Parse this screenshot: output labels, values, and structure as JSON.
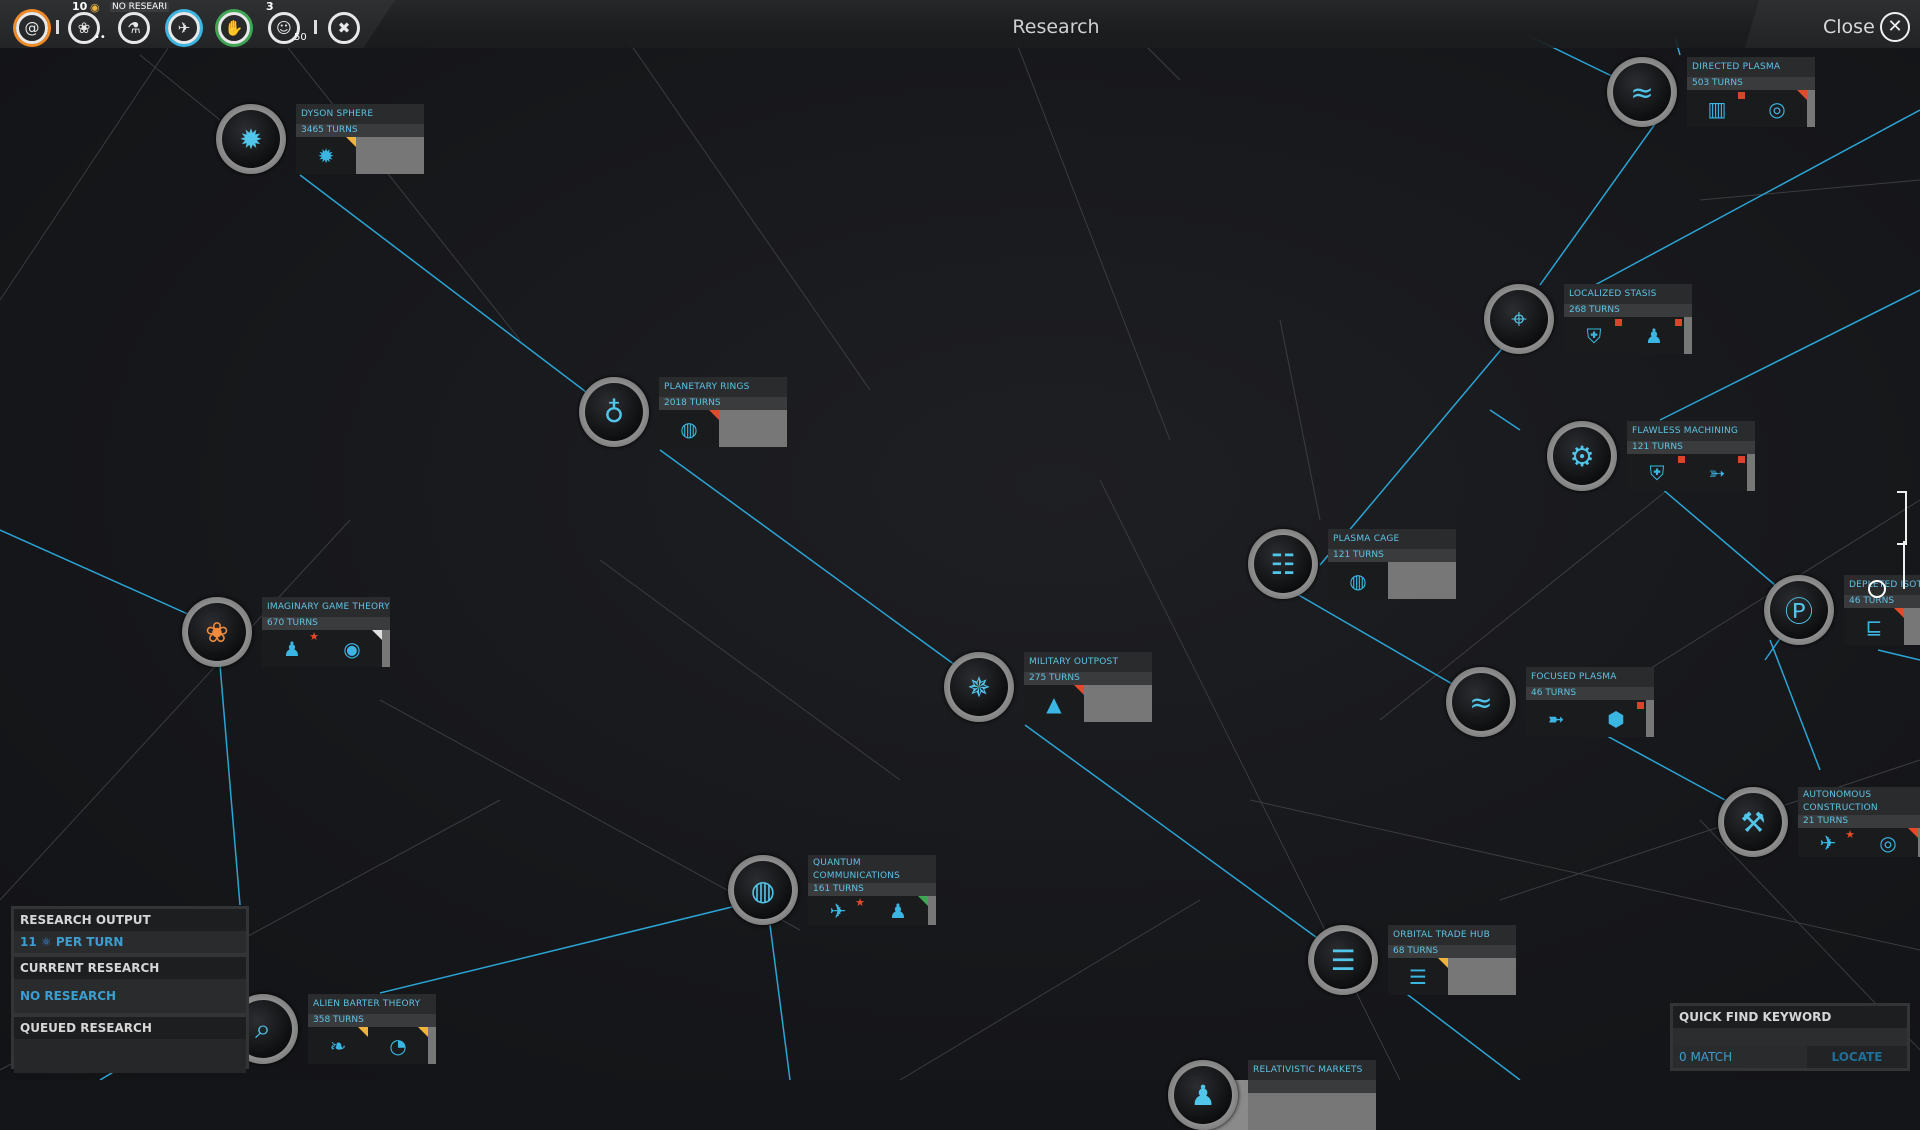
{
  "window": {
    "title": "Research",
    "close_label": "Close",
    "close_icon": "close-circle-icon"
  },
  "toolbar": {
    "items": [
      {
        "name": "galaxy",
        "icon": "spiral-galaxy-icon",
        "glyph": "@",
        "ring": "#f08a24"
      },
      {
        "name": "empire",
        "icon": "laurel-wreath-icon",
        "glyph": "❀",
        "badge_top": "10",
        "badge_icon": "gold-coin-icon",
        "sub_badge": "••"
      },
      {
        "name": "research",
        "icon": "microscope-icon",
        "glyph": "⚗",
        "label": "NO RESEARI",
        "sub_badge": "-"
      },
      {
        "name": "military",
        "icon": "eagle-icon",
        "glyph": "✈",
        "ring": "#3bb6e3"
      },
      {
        "name": "diplomacy",
        "icon": "handshake-icon",
        "glyph": "✋",
        "ring": "#3fa654"
      },
      {
        "name": "population",
        "icon": "people-icon",
        "glyph": "☺",
        "badge_top": "3",
        "sub_badge": "50"
      },
      {
        "name": "settings",
        "icon": "wrench-screwdriver-icon",
        "glyph": "✖"
      }
    ]
  },
  "colors": {
    "accent": "#5ec3e6",
    "line": "#2aa5d6",
    "faint_line": "#3a3c40",
    "warning": "#e24b2a",
    "bonus": "#f0b43c",
    "good": "#3fa654"
  },
  "techs": [
    {
      "id": "dyson-sphere",
      "name": "DYSON SPHERE",
      "turns": "3465 TURNS",
      "icon": "sun-ring-icon",
      "glyph": "✹",
      "unlocks": [
        {
          "icon": "sun-ring-icon",
          "glyph": "✹",
          "flag": "rainbow"
        }
      ]
    },
    {
      "id": "directed-plasma",
      "name": "DIRECTED PLASMA",
      "turns": "503 TURNS",
      "icon": "plasma-beam-icon",
      "glyph": "≈",
      "unlocks": [
        {
          "icon": "battery-cells-icon",
          "glyph": "▥",
          "flag": "square"
        },
        {
          "icon": "laurel-target-icon",
          "glyph": "◎",
          "flag": "corner"
        }
      ]
    },
    {
      "id": "localized-stasis",
      "name": "LOCALIZED STASIS",
      "turns": "268 TURNS",
      "icon": "location-pin-icon",
      "glyph": "⌖",
      "unlocks": [
        {
          "icon": "shield-icon",
          "glyph": "⛨",
          "flag": "square"
        },
        {
          "icon": "engineer-icon",
          "glyph": "♟",
          "flag": "square"
        }
      ]
    },
    {
      "id": "flawless-machining",
      "name": "FLAWLESS MACHINING",
      "turns": "121 TURNS",
      "icon": "gears-icon",
      "glyph": "⚙",
      "unlocks": [
        {
          "icon": "shield-icon",
          "glyph": "⛨",
          "flag": "square"
        },
        {
          "icon": "projectile-crew-icon",
          "glyph": "➳",
          "flag": "square"
        }
      ]
    },
    {
      "id": "planetary-rings",
      "name": "PLANETARY RINGS",
      "turns": "2018 TURNS",
      "icon": "ringed-planet-icon",
      "glyph": "♁",
      "unlocks": [
        {
          "icon": "globe-ring-icon",
          "glyph": "◍",
          "flag": "corner"
        }
      ]
    },
    {
      "id": "plasma-cage",
      "name": "PLASMA CAGE",
      "turns": "121 TURNS",
      "icon": "cage-lightning-icon",
      "glyph": "☷",
      "unlocks": [
        {
          "icon": "globe-lightning-icon",
          "glyph": "◍",
          "flag": ""
        }
      ]
    },
    {
      "id": "depleted-isotopes",
      "name": "DEPLETED ISOTOPES",
      "turns": "46 TURNS",
      "icon": "neutron-proton-icon",
      "glyph": "Ⓟ",
      "unlocks": [
        {
          "icon": "clamp-icon",
          "glyph": "⊑",
          "flag": "corner"
        }
      ]
    },
    {
      "id": "imaginary-game-theory",
      "name": "IMAGINARY GAME THEORY",
      "turns": "670 TURNS",
      "icon": "butterfly-icon",
      "glyph": "❀",
      "unlocks": [
        {
          "icon": "alien-crowd-icon",
          "glyph": "♟",
          "flag": "star"
        },
        {
          "icon": "broadcast-icon",
          "glyph": "◉",
          "flag": "corner-white"
        }
      ]
    },
    {
      "id": "military-outpost",
      "name": "MILITARY OUTPOST",
      "turns": "275 TURNS",
      "icon": "eagle-globe-icon",
      "glyph": "✵",
      "unlocks": [
        {
          "icon": "starfleet-icon",
          "glyph": "▲",
          "flag": "corner"
        }
      ]
    },
    {
      "id": "focused-plasma",
      "name": "FOCUSED PLASMA",
      "turns": "46 TURNS",
      "icon": "plasma-beam-icon",
      "glyph": "≈",
      "unlocks": [
        {
          "icon": "plasma-bolt-icon",
          "glyph": "➼",
          "flag": ""
        },
        {
          "icon": "hex-armor-icon",
          "glyph": "⬢",
          "flag": "square"
        }
      ]
    },
    {
      "id": "autonomous-construction",
      "name": "AUTONOMOUS CONSTRUCTION",
      "turns": "21 TURNS",
      "icon": "factory-robot-icon",
      "glyph": "⚒",
      "unlocks": [
        {
          "icon": "eagle-timer-icon",
          "glyph": "✈",
          "flag": "star"
        },
        {
          "icon": "ring-icon",
          "glyph": "◎",
          "flag": "corner"
        }
      ]
    },
    {
      "id": "quantum-communications",
      "name": "QUANTUM COMMUNICATIONS",
      "turns": "161 TURNS",
      "icon": "globe-signal-icon",
      "glyph": "◍",
      "unlocks": [
        {
          "icon": "eagle-link-icon",
          "glyph": "✈",
          "flag": "star"
        },
        {
          "icon": "people-link-icon",
          "glyph": "♟",
          "flag": "corner-green"
        }
      ]
    },
    {
      "id": "orbital-trade-hub",
      "name": "ORBITAL TRADE HUB",
      "turns": "68 TURNS",
      "icon": "space-station-icon",
      "glyph": "☰",
      "unlocks": [
        {
          "icon": "space-station-icon",
          "glyph": "☰",
          "flag": "corner-yellow"
        }
      ]
    },
    {
      "id": "alien-barter-theory",
      "name": "ALIEN BARTER THEORY",
      "turns": "358 TURNS",
      "icon": "magnifier-icon",
      "glyph": "⌕",
      "unlocks": [
        {
          "icon": "cornucopia-icon",
          "glyph": "❧",
          "flag": "corner-yellow"
        },
        {
          "icon": "gauge-icon",
          "glyph": "◔",
          "flag": "corner-yellow"
        }
      ]
    },
    {
      "id": "relativistic-markets",
      "name": "RELATIVISTIC MARKETS",
      "turns": "",
      "icon": "people-network-icon",
      "glyph": "♟",
      "unlocks": []
    }
  ],
  "research_panel": {
    "output_label": "RESEARCH OUTPUT",
    "output_value": "11",
    "output_icon": "science-atom-icon",
    "output_unit": "PER TURN",
    "current_label": "CURRENT RESEARCH",
    "current_value": "NO RESEARCH",
    "queued_label": "QUEUED RESEARCH"
  },
  "quick_find": {
    "label": "QUICK FIND KEYWORD",
    "input_value": "",
    "match_text": "0 MATCH",
    "locate_label": "LOCATE"
  }
}
